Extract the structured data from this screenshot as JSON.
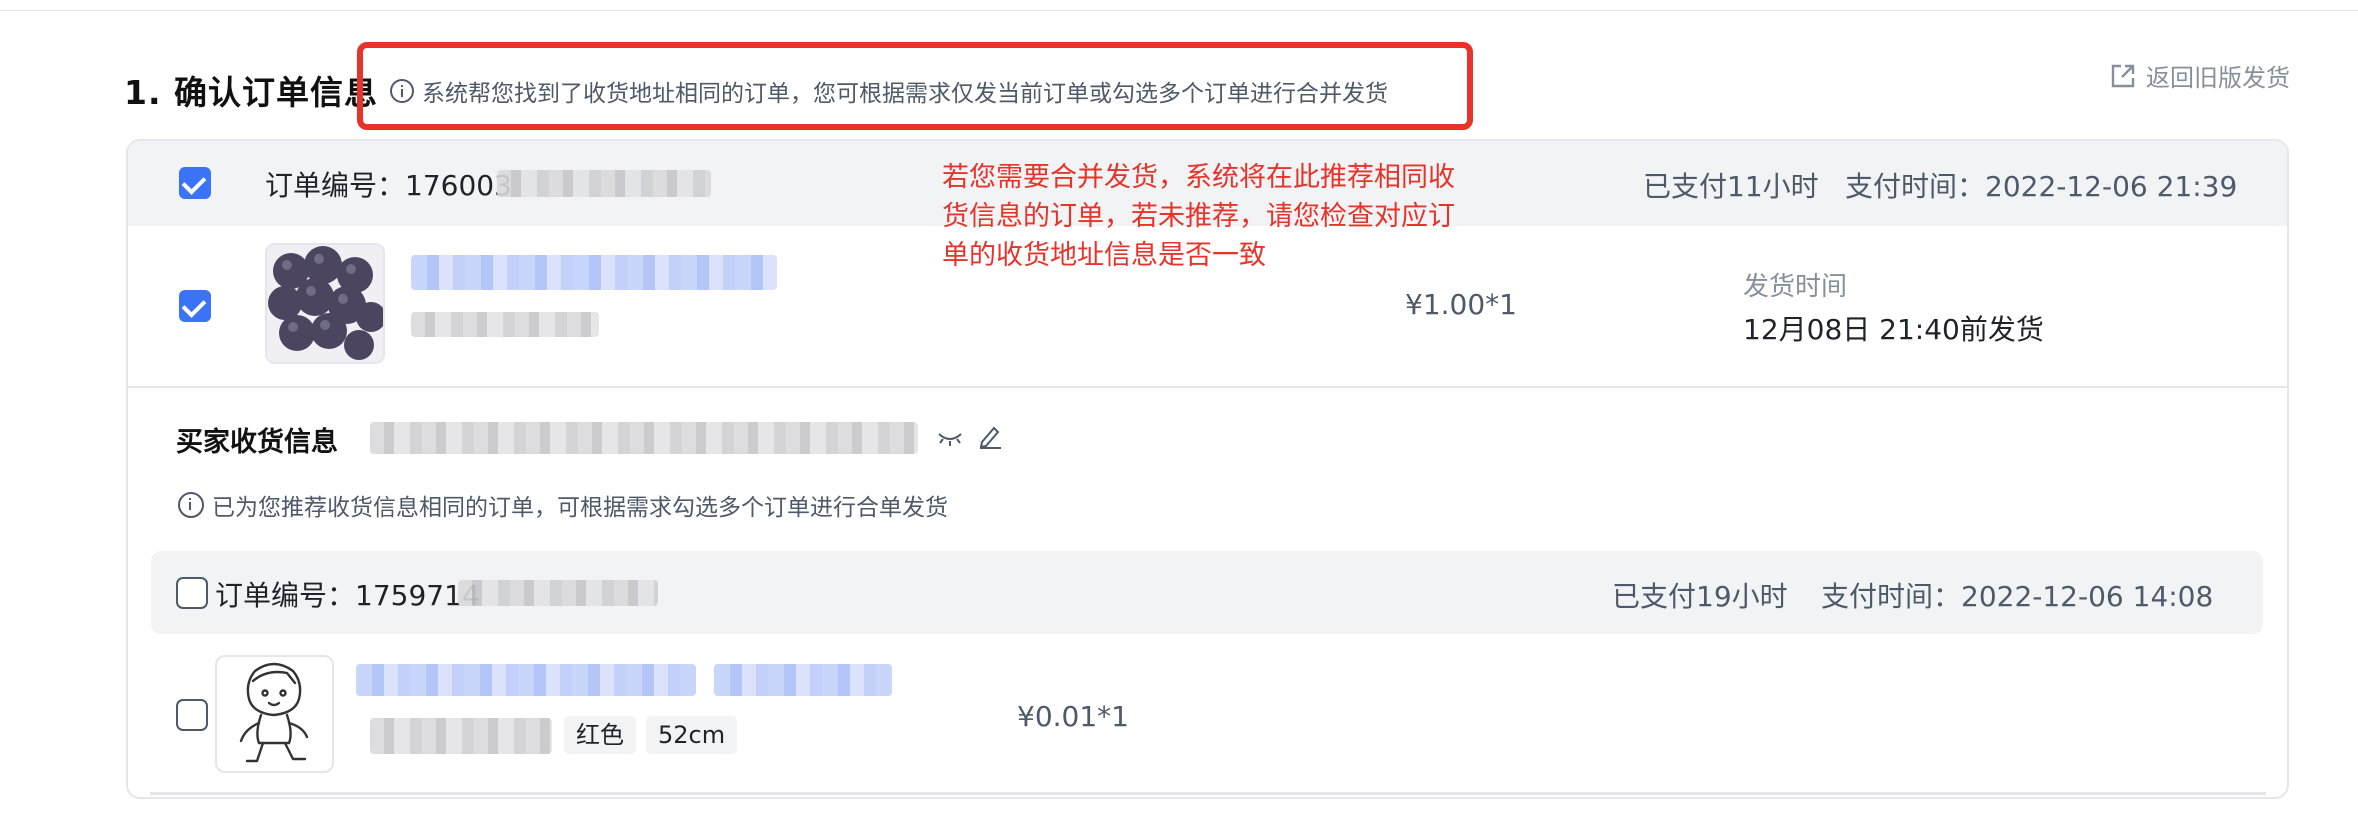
{
  "section": {
    "title": "1. 确认订单信息",
    "notice": "系统帮您找到了收货地址相同的订单，您可根据需求仅发当前订单或勾选多个订单进行合并发货"
  },
  "return_link": {
    "label": "返回旧版发货"
  },
  "annotation": "若您需要合并发货，系统将在此推荐相同收货信息的订单，若未推荐，请您检查对应订单的收货地址信息是否一致",
  "colors": {
    "accent": "#3a73f5",
    "highlight": "#e8332a"
  },
  "order1": {
    "checked": true,
    "id_label": "订单编号：",
    "id_visible": "176003",
    "paid_ago": "已支付11小时",
    "pay_time": "支付时间：2022-12-06 21:39",
    "item": {
      "checked": true,
      "image": "grapes-photo",
      "price": "¥1.00*1",
      "ship_label": "发货时间",
      "ship_deadline": "12月08日 21:40前发货"
    }
  },
  "buyer": {
    "title": "买家收货信息",
    "hint": "已为您推荐收货信息相同的订单，可根据需求勾选多个订单进行合单发货"
  },
  "order2": {
    "checked": false,
    "id_label": "订单编号：",
    "id_visible": "1759714",
    "paid_ago": "已支付19小时",
    "pay_time": "支付时间：2022-12-06 14:08",
    "item": {
      "checked": false,
      "image": "cartoon-child-drawing",
      "tags": [
        "红色",
        "52cm"
      ],
      "price": "¥0.01*1"
    }
  }
}
